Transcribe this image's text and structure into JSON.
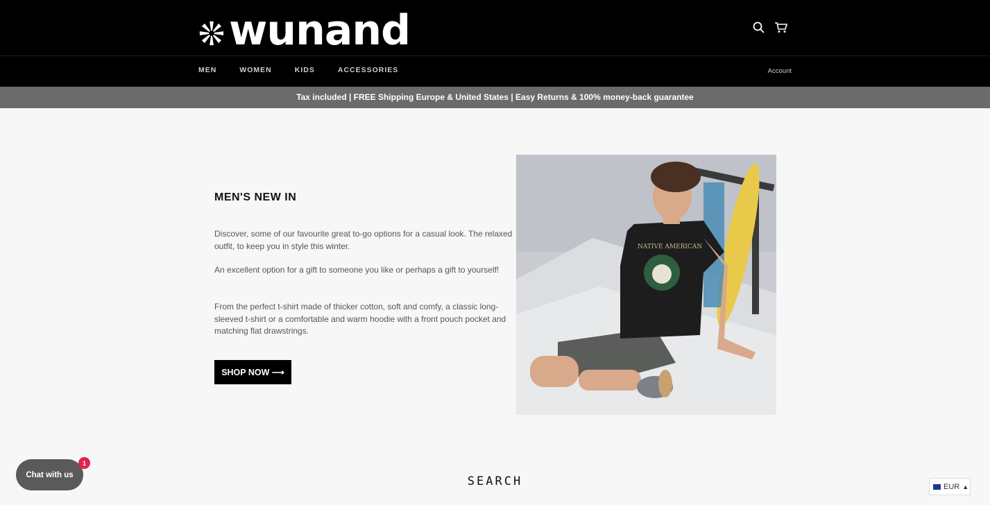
{
  "header": {
    "logo_text": "wunand",
    "search_icon": "search-icon",
    "cart_icon": "cart-icon",
    "nav": [
      {
        "label": "MEN"
      },
      {
        "label": "WOMEN"
      },
      {
        "label": "KIDS"
      },
      {
        "label": "ACCESSORIES"
      }
    ],
    "account_label": "Account"
  },
  "announcement": "Tax included | FREE Shipping Europe & United States | Easy Returns & 100% money-back guarantee",
  "feature": {
    "title": "MEN'S NEW IN",
    "paragraphs": [
      "Discover, some of our favourite great to-go options for a casual look. The relaxed outfit, to keep you in style this winter.",
      "An excellent option for a gift to someone you like or perhaps a gift to yourself!",
      "From the perfect t-shirt made of thicker cotton, soft and comfy, a classic long-sleeved t-shirt or a comfortable and warm hoodie with a front pouch pocket and matching flat drawstrings."
    ],
    "button_label": "SHOP NOW ⟶",
    "image_shirt_text": "NATIVE AMERICAN"
  },
  "search_title": "SEARCH",
  "chat": {
    "label": "Chat with us",
    "badge": "1"
  },
  "currency": {
    "selected": "EUR"
  },
  "colors": {
    "header_bg": "#000000",
    "announce_bg": "#6b6b6b",
    "badge": "#e0244b"
  }
}
